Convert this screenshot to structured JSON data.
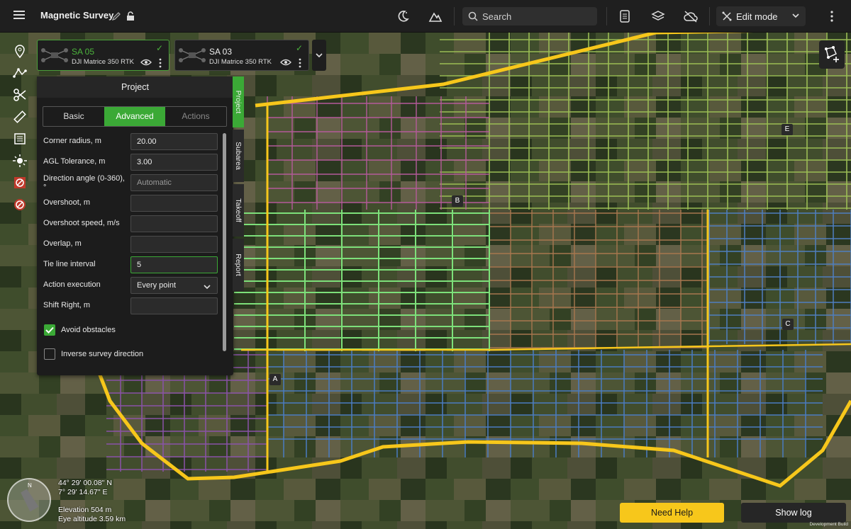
{
  "app": {
    "title": "Magnetic Survey"
  },
  "topbar": {
    "search_placeholder": "Search",
    "edit_mode_label": "Edit mode",
    "icons": [
      "night-mode-icon",
      "terrain-icon",
      "search-icon",
      "checklist-icon",
      "layers-icon",
      "cloud-off-icon",
      "edit-mode-icon",
      "more-icon"
    ]
  },
  "drones": [
    {
      "name": "SA 05",
      "model": "DJI Matrice 350 RTK",
      "selected": true
    },
    {
      "name": "SA 03",
      "model": "DJI Matrice 350 RTK",
      "selected": false
    }
  ],
  "panel": {
    "title": "Project",
    "tabs": {
      "basic": "Basic",
      "advanced": "Advanced",
      "actions": "Actions"
    },
    "fields": {
      "corner_radius": {
        "label": "Corner radius, m",
        "value": "20.00"
      },
      "agl_tolerance": {
        "label": "AGL Tolerance, m",
        "value": "3.00"
      },
      "direction_angle": {
        "label": "Direction angle (0-360), °",
        "value": "Automatic"
      },
      "overshoot": {
        "label": "Overshoot, m",
        "value": ""
      },
      "overshoot_speed": {
        "label": "Overshoot speed, m/s",
        "value": ""
      },
      "overlap": {
        "label": "Overlap, m",
        "value": ""
      },
      "tie_line_interval": {
        "label": "Tie line interval",
        "value": "5"
      },
      "action_execution": {
        "label": "Action execution",
        "value": "Every point"
      },
      "shift_right": {
        "label": "Shift Right, m",
        "value": ""
      }
    },
    "checkboxes": {
      "avoid_obstacles": {
        "label": "Avoid obstacles",
        "checked": true
      },
      "inverse_direction": {
        "label": "Inverse survey direction",
        "checked": false
      }
    },
    "side_tabs": {
      "project": "Project",
      "subarea": "Subarea",
      "takeoff": "Takeoff",
      "report": "Report"
    }
  },
  "map": {
    "markers": [
      "A",
      "B",
      "C",
      "E"
    ],
    "latitude": "44° 29' 00.08\" N",
    "longitude": "7° 29' 14.67\" E",
    "elevation": "Elevation 504 m",
    "eye_altitude": "Eye altitude 3.59 km",
    "compass_north": "N"
  },
  "footer": {
    "need_help": "Need Help",
    "show_log": "Show log",
    "dev_build": "Development Build"
  },
  "colors": {
    "accent_green": "#3ba936",
    "boundary_yellow": "#f7c71b"
  }
}
